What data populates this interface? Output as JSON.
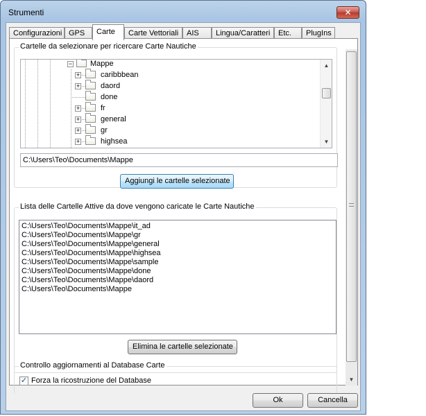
{
  "window": {
    "title": "Strumenti",
    "close_label": "✕"
  },
  "tabs": [
    {
      "label": "Configurazioni",
      "active": false
    },
    {
      "label": "GPS",
      "active": false
    },
    {
      "label": "Carte",
      "active": true
    },
    {
      "label": "Carte Vettoriali",
      "active": false
    },
    {
      "label": "AIS",
      "active": false
    },
    {
      "label": "Lingua/Caratteri",
      "active": false
    },
    {
      "label": "Etc.",
      "active": false
    },
    {
      "label": "PlugIns",
      "active": false
    }
  ],
  "folders_group": {
    "title": "Cartelle da selezionare per ricercare Carte Nautiche",
    "tree": {
      "root": "Mappe",
      "children": [
        {
          "label": "caribbbean",
          "expandable": true
        },
        {
          "label": "daord",
          "expandable": true
        },
        {
          "label": "done",
          "expandable": false
        },
        {
          "label": "fr",
          "expandable": true
        },
        {
          "label": "general",
          "expandable": true
        },
        {
          "label": "gr",
          "expandable": true
        },
        {
          "label": "highsea",
          "expandable": true
        }
      ]
    },
    "path_value": "C:\\Users\\Teo\\Documents\\Mappe",
    "add_button": "Aggiungi le cartelle selezionate"
  },
  "active_group": {
    "title": "Lista delle Cartelle Attive da dove vengono caricate le Carte Nautiche",
    "items": [
      "C:\\Users\\Teo\\Documents\\Mappe\\it_ad",
      "C:\\Users\\Teo\\Documents\\Mappe\\gr",
      "C:\\Users\\Teo\\Documents\\Mappe\\general",
      "C:\\Users\\Teo\\Documents\\Mappe\\highsea",
      "C:\\Users\\Teo\\Documents\\Mappe\\sample",
      "C:\\Users\\Teo\\Documents\\Mappe\\done",
      "C:\\Users\\Teo\\Documents\\Mappe\\daord",
      "C:\\Users\\Teo\\Documents\\Mappe"
    ],
    "remove_button": "Elimina le cartelle selezionate"
  },
  "db_group": {
    "title": "Controllo aggiornamenti al Database Carte",
    "rebuild_label": "Forza la ricostruzione del Database",
    "rebuild_checked": true
  },
  "footer": {
    "ok": "Ok",
    "cancel": "Cancella"
  },
  "icons": {
    "close": "close-icon",
    "folder": "folder-icon",
    "expand": "plus-icon",
    "collapse": "minus-icon",
    "check": "check-icon"
  }
}
